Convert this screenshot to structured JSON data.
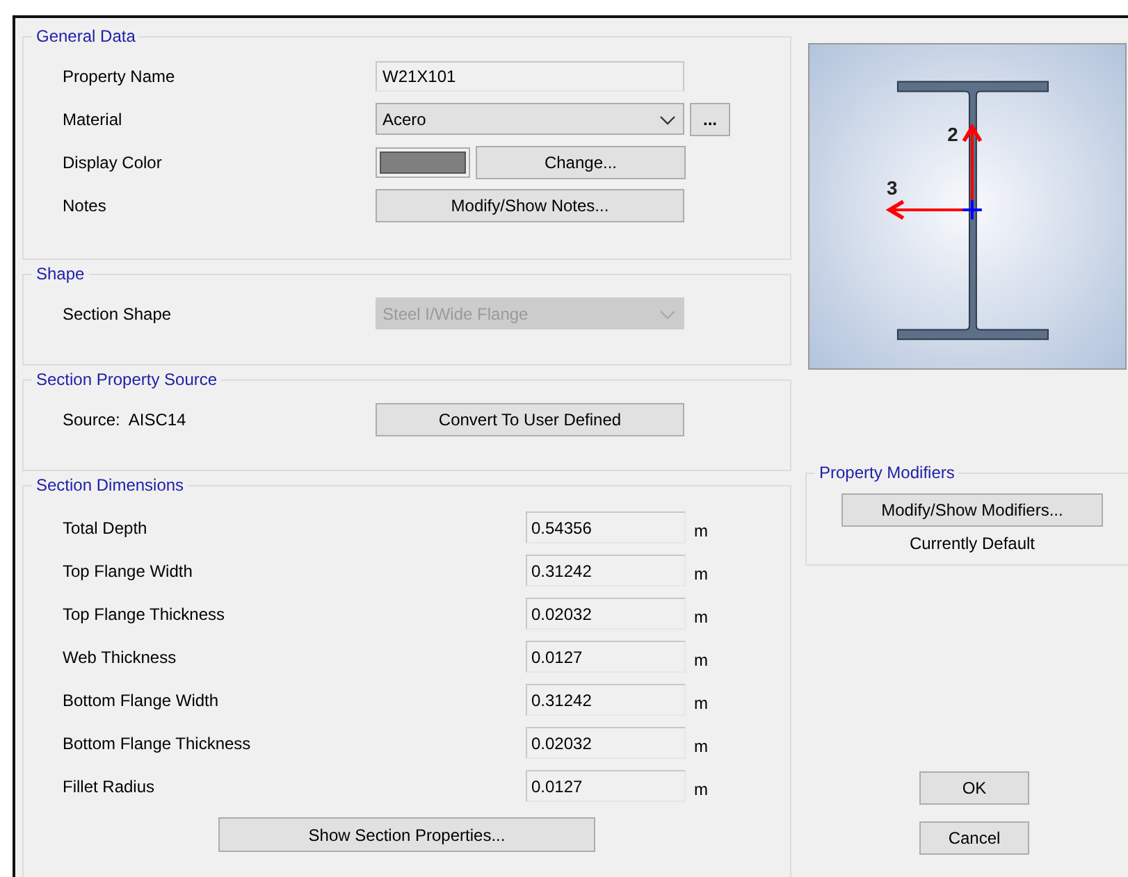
{
  "general_data": {
    "title": "General Data",
    "property_name": {
      "label": "Property Name",
      "value": "W21X101"
    },
    "material": {
      "label": "Material",
      "value": "Acero",
      "more_button": "..."
    },
    "display_color": {
      "label": "Display Color",
      "color": "#7f7f7f",
      "button": "Change..."
    },
    "notes": {
      "label": "Notes",
      "button": "Modify/Show Notes..."
    }
  },
  "shape": {
    "title": "Shape",
    "section_shape": {
      "label": "Section Shape",
      "value": "Steel I/Wide Flange",
      "disabled": true
    }
  },
  "source": {
    "title": "Section Property Source",
    "label": "Source:",
    "value": "AISC14",
    "button": "Convert To User Defined"
  },
  "dimensions": {
    "title": "Section Dimensions",
    "rows": [
      {
        "label": "Total Depth",
        "value": "0.54356",
        "unit": "m"
      },
      {
        "label": "Top Flange Width",
        "value": "0.31242",
        "unit": "m"
      },
      {
        "label": "Top Flange Thickness",
        "value": "0.02032",
        "unit": "m"
      },
      {
        "label": "Web Thickness",
        "value": "0.0127",
        "unit": "m"
      },
      {
        "label": "Bottom Flange Width",
        "value": "0.31242",
        "unit": "m"
      },
      {
        "label": "Bottom Flange Thickness",
        "value": "0.02032",
        "unit": "m"
      },
      {
        "label": "Fillet Radius",
        "value": "0.0127",
        "unit": "m"
      }
    ],
    "button": "Show Section Properties..."
  },
  "preview": {
    "axis_labels": [
      "2",
      "3"
    ]
  },
  "property_modifiers": {
    "title": "Property Modifiers",
    "button": "Modify/Show Modifiers...",
    "status": "Currently Default"
  },
  "buttons": [
    "OK",
    "Cancel"
  ]
}
